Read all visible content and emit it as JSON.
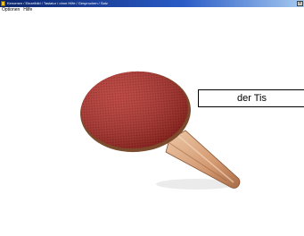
{
  "window": {
    "title": "Kenomen / Einzelbild / Tastatur / ohne Hilfe / Gesprochen / Satz",
    "close_glyph": "×"
  },
  "menu": {
    "items": [
      "Optionen",
      "Hilfe"
    ]
  },
  "card": {
    "word": "der Tis",
    "image": "table-tennis-paddle"
  },
  "colors": {
    "titlebar": "#0a246a",
    "paddle_rubber": "#b5322c",
    "handle": "#d9a07a"
  }
}
